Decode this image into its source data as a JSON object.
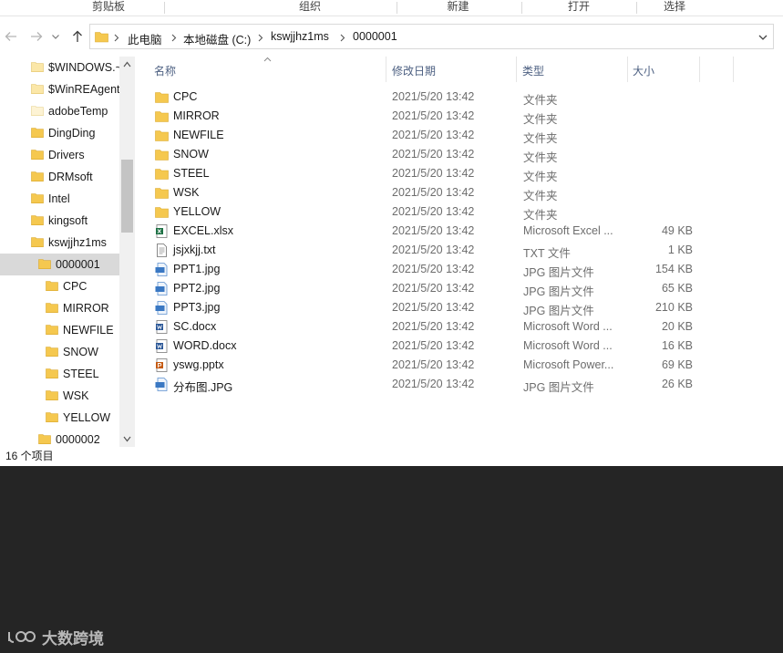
{
  "ribbon": {
    "groups": [
      "剪贴板",
      "组织",
      "新建",
      "打开",
      "选择"
    ]
  },
  "address": {
    "crumbs": [
      "此电脑",
      "本地磁盘 (C:)",
      "kswjjhz1ms",
      "0000001"
    ]
  },
  "tree": {
    "items": [
      {
        "label": "$WINDOWS.~"
      },
      {
        "label": "$WinREAgent"
      },
      {
        "label": "adobeTemp"
      },
      {
        "label": "DingDing"
      },
      {
        "label": "Drivers"
      },
      {
        "label": "DRMsoft"
      },
      {
        "label": "Intel"
      },
      {
        "label": "kingsoft"
      },
      {
        "label": "kswjjhz1ms"
      },
      {
        "label": "0000001"
      },
      {
        "label": "CPC"
      },
      {
        "label": "MIRROR"
      },
      {
        "label": "NEWFILE"
      },
      {
        "label": "SNOW"
      },
      {
        "label": "STEEL"
      },
      {
        "label": "WSK"
      },
      {
        "label": "YELLOW"
      },
      {
        "label": "0000002"
      }
    ]
  },
  "columns": {
    "name": "名称",
    "date": "修改日期",
    "type": "类型",
    "size": "大小"
  },
  "files": [
    {
      "name": "CPC",
      "date": "2021/5/20 13:42",
      "type": "文件夹",
      "size": "",
      "icon": "folder-icon"
    },
    {
      "name": "MIRROR",
      "date": "2021/5/20 13:42",
      "type": "文件夹",
      "size": "",
      "icon": "folder-icon"
    },
    {
      "name": "NEWFILE",
      "date": "2021/5/20 13:42",
      "type": "文件夹",
      "size": "",
      "icon": "folder-icon"
    },
    {
      "name": "SNOW",
      "date": "2021/5/20 13:42",
      "type": "文件夹",
      "size": "",
      "icon": "folder-icon"
    },
    {
      "name": "STEEL",
      "date": "2021/5/20 13:42",
      "type": "文件夹",
      "size": "",
      "icon": "folder-icon"
    },
    {
      "name": "WSK",
      "date": "2021/5/20 13:42",
      "type": "文件夹",
      "size": "",
      "icon": "folder-icon"
    },
    {
      "name": "YELLOW",
      "date": "2021/5/20 13:42",
      "type": "文件夹",
      "size": "",
      "icon": "folder-icon"
    },
    {
      "name": "EXCEL.xlsx",
      "date": "2021/5/20 13:42",
      "type": "Microsoft Excel ...",
      "size": "49 KB",
      "icon": "excel-file-icon"
    },
    {
      "name": "jsjxkjj.txt",
      "date": "2021/5/20 13:42",
      "type": "TXT 文件",
      "size": "1 KB",
      "icon": "text-file-icon"
    },
    {
      "name": "PPT1.jpg",
      "date": "2021/5/20 13:42",
      "type": "JPG 图片文件",
      "size": "154 KB",
      "icon": "jpg-file-icon"
    },
    {
      "name": "PPT2.jpg",
      "date": "2021/5/20 13:42",
      "type": "JPG 图片文件",
      "size": "65 KB",
      "icon": "jpg-file-icon"
    },
    {
      "name": "PPT3.jpg",
      "date": "2021/5/20 13:42",
      "type": "JPG 图片文件",
      "size": "210 KB",
      "icon": "jpg-file-icon"
    },
    {
      "name": "SC.docx",
      "date": "2021/5/20 13:42",
      "type": "Microsoft Word ...",
      "size": "20 KB",
      "icon": "word-file-icon"
    },
    {
      "name": "WORD.docx",
      "date": "2021/5/20 13:42",
      "type": "Microsoft Word ...",
      "size": "16 KB",
      "icon": "word-file-icon"
    },
    {
      "name": "yswg.pptx",
      "date": "2021/5/20 13:42",
      "type": "Microsoft Power...",
      "size": "69 KB",
      "icon": "powerpoint-file-icon"
    },
    {
      "name": "分布图.JPG",
      "date": "2021/5/20 13:42",
      "type": "JPG 图片文件",
      "size": "26 KB",
      "icon": "jpg-file-icon"
    }
  ],
  "status": {
    "count_text": "16 个项目"
  },
  "watermark": {
    "text": "大数跨境"
  }
}
